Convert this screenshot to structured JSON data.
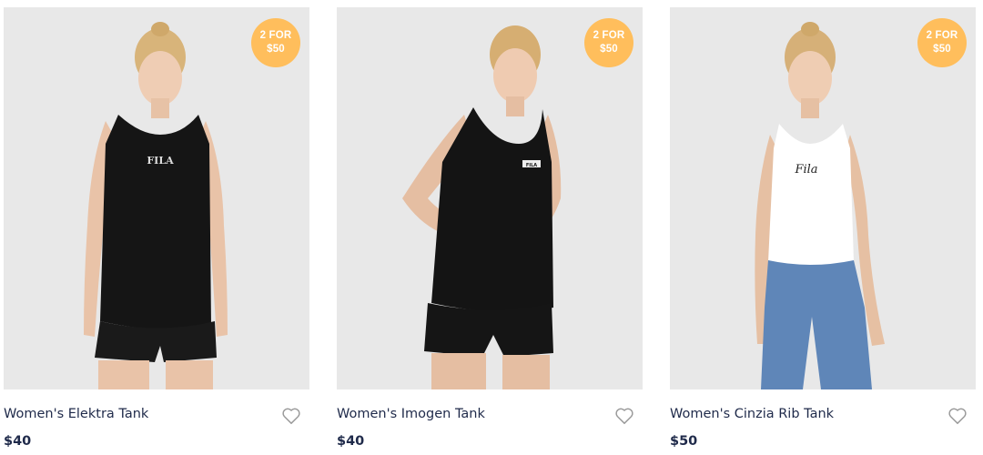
{
  "products": [
    {
      "name": "Women's Elektra Tank",
      "price": "$40",
      "badge": {
        "line1": "2 FOR",
        "line2": "$50"
      },
      "top_color": "#151515",
      "bottom_color": "#1a1a1a",
      "legs_color": "#e9c3a8",
      "logo": "FILA"
    },
    {
      "name": "Women's Imogen Tank",
      "price": "$40",
      "badge": {
        "line1": "2 FOR",
        "line2": "$50"
      },
      "top_color": "#141414",
      "bottom_color": "#151515",
      "legs_color": "#e5bea2",
      "logo": "FILA"
    },
    {
      "name": "Women's Cinzia Rib Tank",
      "price": "$50",
      "badge": {
        "line1": "2 FOR",
        "line2": "$50"
      },
      "top_color": "#ffffff",
      "bottom_color": "#5f86b8",
      "legs_color": "#e6c0a3",
      "logo": "Fila"
    }
  ],
  "colors": {
    "image_bg": "#e8e8e8",
    "badge_bg": "#ffbe5c",
    "text": "#1f2a4a",
    "heart_stroke": "#9a9a9a"
  },
  "icons": {
    "wishlist": "heart-outline-icon"
  }
}
